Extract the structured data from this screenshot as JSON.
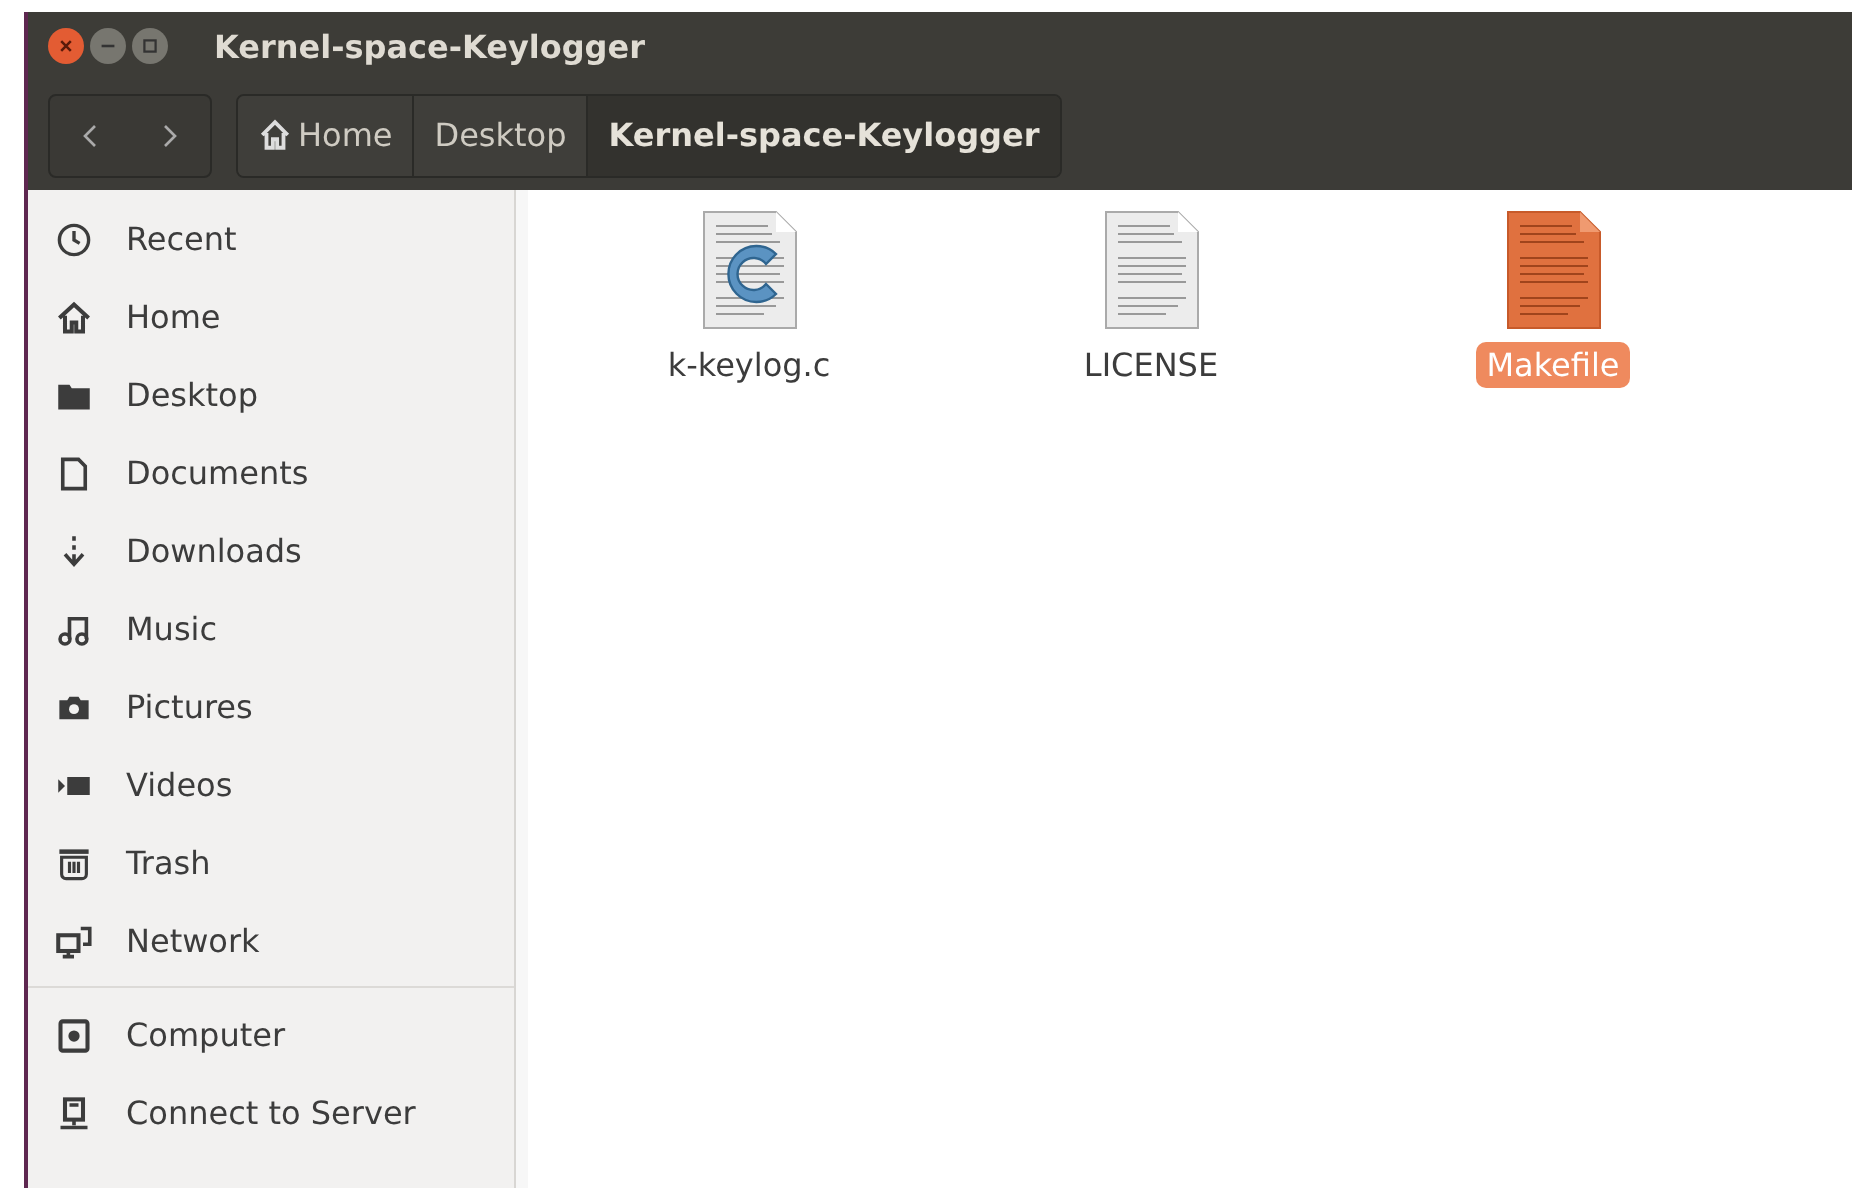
{
  "window": {
    "title": "Kernel-space-Keylogger"
  },
  "breadcrumbs": [
    {
      "label": "Home",
      "kind": "home",
      "selected": false
    },
    {
      "label": "Desktop",
      "kind": "plain",
      "selected": false
    },
    {
      "label": "Kernel-space-Keylogger",
      "kind": "plain",
      "selected": true
    }
  ],
  "sidebar": {
    "sections": [
      {
        "items": [
          {
            "label": "Recent",
            "kind": "recent"
          },
          {
            "label": "Home",
            "kind": "home"
          },
          {
            "label": "Desktop",
            "kind": "desktop"
          },
          {
            "label": "Documents",
            "kind": "documents"
          },
          {
            "label": "Downloads",
            "kind": "downloads"
          },
          {
            "label": "Music",
            "kind": "music"
          },
          {
            "label": "Pictures",
            "kind": "pictures"
          },
          {
            "label": "Videos",
            "kind": "videos"
          },
          {
            "label": "Trash",
            "kind": "trash"
          },
          {
            "label": "Network",
            "kind": "network"
          }
        ]
      },
      {
        "items": [
          {
            "label": "Computer",
            "kind": "computer"
          },
          {
            "label": "Connect to Server",
            "kind": "server"
          }
        ]
      }
    ]
  },
  "files": [
    {
      "name": "k-keylog.c",
      "kind": "c",
      "selected": false
    },
    {
      "name": "LICENSE",
      "kind": "text",
      "selected": false
    },
    {
      "name": "Makefile",
      "kind": "text",
      "selected": true
    }
  ]
}
